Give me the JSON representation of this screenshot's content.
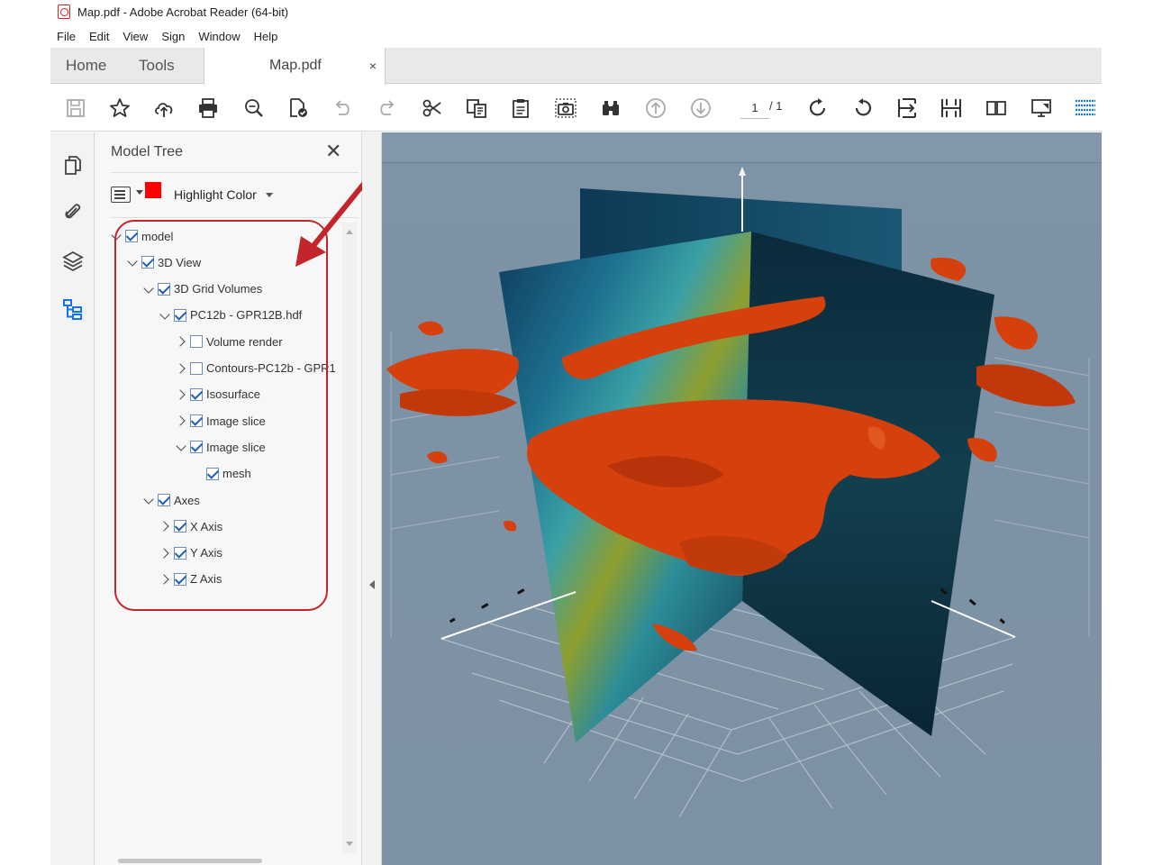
{
  "window": {
    "title": "Map.pdf - Adobe Acrobat Reader (64-bit)"
  },
  "menu": [
    "File",
    "Edit",
    "View",
    "Sign",
    "Window",
    "Help"
  ],
  "tabs": {
    "home": "Home",
    "tools": "Tools",
    "document": "Map.pdf",
    "close": "×"
  },
  "toolbar": {
    "page_current": "1",
    "page_total": "/ 1"
  },
  "panel": {
    "title": "Model Tree",
    "close": "✕",
    "highlight_label": "Highlight Color",
    "highlight_color": "#ff0000"
  },
  "tree": [
    {
      "label": "model",
      "level": 0,
      "expanded": true,
      "checked": true
    },
    {
      "label": "3D View",
      "level": 1,
      "expanded": true,
      "checked": true
    },
    {
      "label": "3D Grid Volumes",
      "level": 2,
      "expanded": true,
      "checked": true
    },
    {
      "label": "PC12b - GPR12B.hdf",
      "level": 3,
      "expanded": true,
      "checked": true
    },
    {
      "label": "Volume render",
      "level": 4,
      "expanded": false,
      "checked": false
    },
    {
      "label": "Contours-PC12b - GPR1",
      "level": 4,
      "expanded": false,
      "checked": false
    },
    {
      "label": "Isosurface",
      "level": 4,
      "expanded": false,
      "checked": true
    },
    {
      "label": "Image slice",
      "level": 4,
      "expanded": false,
      "checked": true
    },
    {
      "label": "Image slice",
      "level": 4,
      "expanded": true,
      "checked": true
    },
    {
      "label": "mesh",
      "level": 5,
      "expanded": null,
      "checked": true
    },
    {
      "label": "Axes",
      "level": 2,
      "expanded": true,
      "checked": true
    },
    {
      "label": "X Axis",
      "level": 3,
      "expanded": false,
      "checked": true
    },
    {
      "label": "Y Axis",
      "level": 3,
      "expanded": false,
      "checked": true
    },
    {
      "label": "Z Axis",
      "level": 3,
      "expanded": false,
      "checked": true
    }
  ],
  "colors": {
    "accent": "#1473e6",
    "annotation": "#c4242b",
    "viewer_bg": "#7f93a6",
    "isosurface": "#d6400c"
  }
}
